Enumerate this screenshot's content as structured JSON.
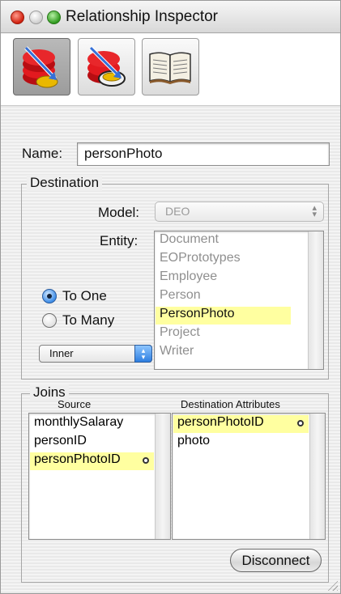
{
  "window": {
    "title": "Relationship Inspector"
  },
  "toolbar": {
    "buttons": [
      {
        "name": "relationship-inspector",
        "active": true
      },
      {
        "name": "advanced-relationship-inspector",
        "active": false
      },
      {
        "name": "documentation",
        "active": false
      }
    ]
  },
  "name_field": {
    "label": "Name:",
    "value": "personPhoto"
  },
  "destination": {
    "group_label": "Destination",
    "model_label": "Model:",
    "model_value": "DEO",
    "entity_label": "Entity:",
    "entities": [
      "Document",
      "EOPrototypes",
      "Employee",
      "Person",
      "PersonPhoto",
      "Project",
      "Writer"
    ],
    "selected_entity": "PersonPhoto",
    "to_one_label": "To One",
    "to_many_label": "To Many",
    "cardinality": "to-one",
    "join_type": "Inner"
  },
  "joins": {
    "group_label": "Joins",
    "source_header": "Source",
    "destination_header": "Destination Attributes",
    "source_attributes": [
      "monthlySalaray",
      "personID",
      "personPhotoID"
    ],
    "selected_source": "personPhotoID",
    "destination_attributes": [
      "personPhotoID",
      "photo"
    ],
    "selected_destination": "personPhotoID",
    "disconnect_label": "Disconnect"
  },
  "colors": {
    "selection": "#ffffa0",
    "accent": "#3f8ee8"
  }
}
